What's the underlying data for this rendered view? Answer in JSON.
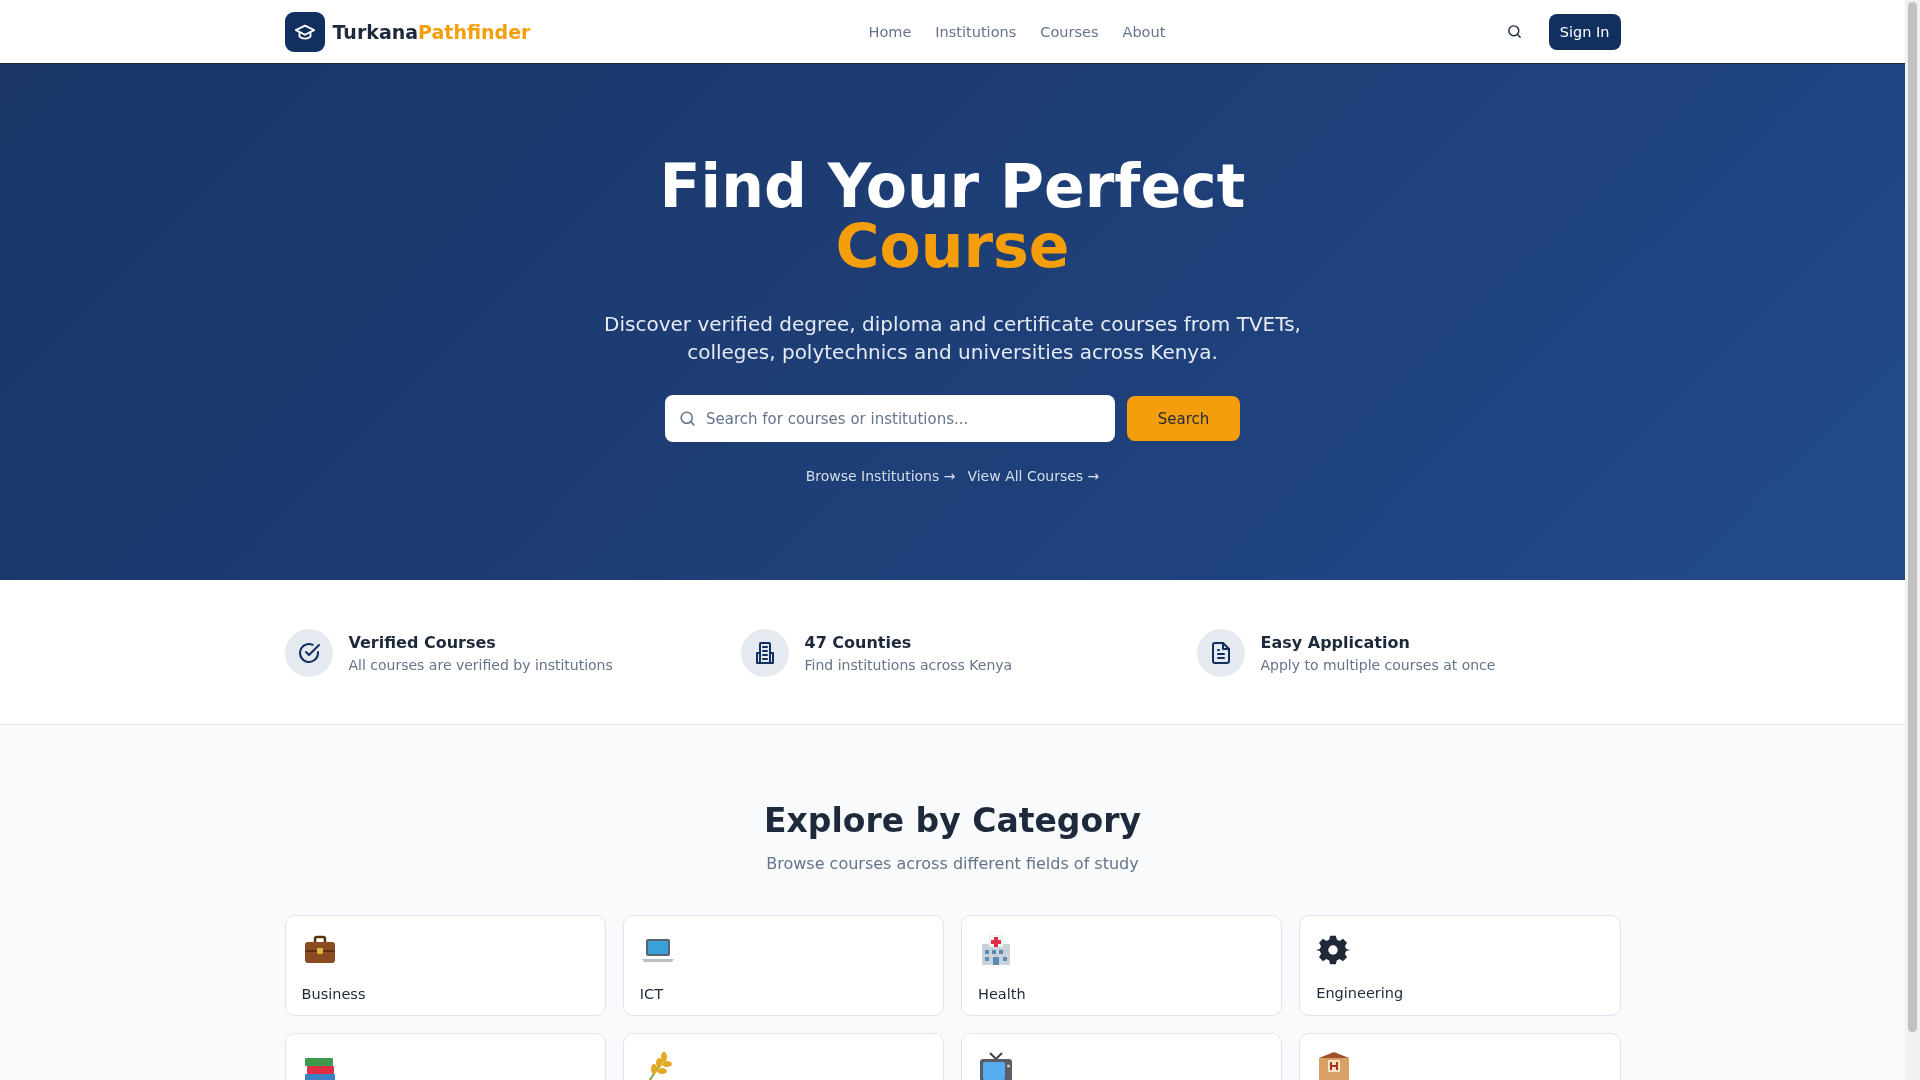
{
  "header": {
    "logo": {
      "first": "Turkana",
      "second": "Pathfinder"
    },
    "nav": [
      {
        "label": "Home"
      },
      {
        "label": "Institutions"
      },
      {
        "label": "Courses"
      },
      {
        "label": "About"
      }
    ],
    "sign_in": "Sign In"
  },
  "hero": {
    "title_line1": "Find Your Perfect",
    "title_line2": "Course",
    "subtitle": "Discover verified degree, diploma and certificate courses from TVETs, colleges, polytechnics and universities across Kenya.",
    "search": {
      "placeholder": "Search for courses or institutions..."
    },
    "search_button": "Search",
    "links": [
      "Browse Institutions →",
      "View All Courses →"
    ]
  },
  "features": [
    {
      "title": "Verified Courses",
      "text": "All courses are verified by institutions"
    },
    {
      "title": "47 Counties",
      "text": "Find institutions across Kenya"
    },
    {
      "title": "Easy Application",
      "text": "Apply to multiple courses at once"
    }
  ],
  "categories": {
    "title": "Explore by Category",
    "subtitle": "Browse courses across different fields of study",
    "items": [
      {
        "kind": "labeled",
        "label": "Business"
      },
      {
        "kind": "labeled",
        "label": "ICT"
      },
      {
        "kind": "labeled",
        "label": "Health"
      },
      {
        "kind": "labeled",
        "label": "Engineering"
      },
      {
        "kind": "icon_only"
      },
      {
        "kind": "icon_only"
      },
      {
        "kind": "icon_only"
      },
      {
        "kind": "icon_only"
      }
    ]
  }
}
